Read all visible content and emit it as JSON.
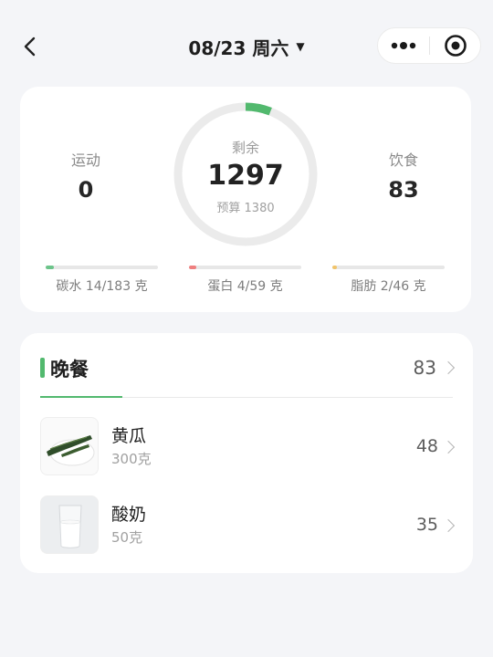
{
  "header": {
    "title": "08/23 周六",
    "caret": "▼",
    "back_icon": "chevron-left-icon",
    "more_icon": "more-dots-icon",
    "target_icon": "target-icon"
  },
  "summary": {
    "exercise": {
      "label": "运动",
      "value": "0"
    },
    "remaining": {
      "label": "剩余",
      "value": "1297",
      "budget": "预算 1380",
      "progress_fraction": 0.06
    },
    "diet": {
      "label": "饮食",
      "value": "83"
    },
    "macros": [
      {
        "label": "碳水 14/183 克",
        "fraction": 0.077,
        "color": "#6cc48a"
      },
      {
        "label": "蛋白 4/59 克",
        "fraction": 0.068,
        "color": "#ef7f7f"
      },
      {
        "label": "脂肪 2/46 克",
        "fraction": 0.043,
        "color": "#f1c46a"
      }
    ]
  },
  "meal": {
    "name": "晚餐",
    "total": "83",
    "accent": "#52b96e",
    "items": [
      {
        "name": "黄瓜",
        "qty": "300克",
        "cal": "48"
      },
      {
        "name": "酸奶",
        "qty": "50克",
        "cal": "35"
      }
    ]
  }
}
